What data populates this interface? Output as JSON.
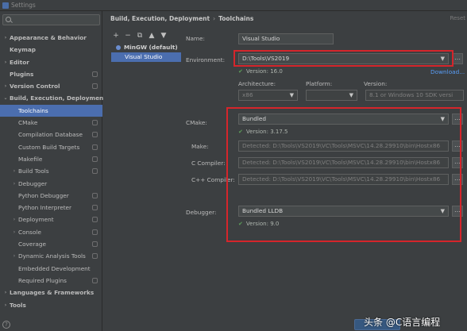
{
  "window": {
    "title": "Settings"
  },
  "sidebar": {
    "items": [
      {
        "label": "Appearance & Behavior",
        "bold": true,
        "arrow": "›",
        "depth": 0
      },
      {
        "label": "Keymap",
        "bold": true,
        "arrow": "",
        "depth": 0
      },
      {
        "label": "Editor",
        "bold": true,
        "arrow": "›",
        "depth": 0
      },
      {
        "label": "Plugins",
        "bold": true,
        "arrow": "",
        "depth": 0,
        "cfg": true
      },
      {
        "label": "Version Control",
        "bold": true,
        "arrow": "›",
        "depth": 0,
        "cfg": true
      },
      {
        "label": "Build, Execution, Deployment",
        "bold": true,
        "arrow": "⌄",
        "depth": 0
      },
      {
        "label": "Toolchains",
        "bold": false,
        "arrow": "",
        "depth": 1,
        "selected": true
      },
      {
        "label": "CMake",
        "bold": false,
        "arrow": "",
        "depth": 1,
        "cfg": true
      },
      {
        "label": "Compilation Database",
        "bold": false,
        "arrow": "",
        "depth": 1,
        "cfg": true
      },
      {
        "label": "Custom Build Targets",
        "bold": false,
        "arrow": "",
        "depth": 1,
        "cfg": true
      },
      {
        "label": "Makefile",
        "bold": false,
        "arrow": "",
        "depth": 1,
        "cfg": true
      },
      {
        "label": "Build Tools",
        "bold": false,
        "arrow": "›",
        "depth": 1,
        "cfg": true
      },
      {
        "label": "Debugger",
        "bold": false,
        "arrow": "›",
        "depth": 1
      },
      {
        "label": "Python Debugger",
        "bold": false,
        "arrow": "",
        "depth": 1,
        "cfg": true
      },
      {
        "label": "Python Interpreter",
        "bold": false,
        "arrow": "",
        "depth": 1,
        "cfg": true
      },
      {
        "label": "Deployment",
        "bold": false,
        "arrow": "›",
        "depth": 1,
        "cfg": true
      },
      {
        "label": "Console",
        "bold": false,
        "arrow": "›",
        "depth": 1,
        "cfg": true
      },
      {
        "label": "Coverage",
        "bold": false,
        "arrow": "",
        "depth": 1,
        "cfg": true
      },
      {
        "label": "Dynamic Analysis Tools",
        "bold": false,
        "arrow": "›",
        "depth": 1,
        "cfg": true
      },
      {
        "label": "Embedded Development",
        "bold": false,
        "arrow": "",
        "depth": 1
      },
      {
        "label": "Required Plugins",
        "bold": false,
        "arrow": "",
        "depth": 1,
        "cfg": true
      },
      {
        "label": "Languages & Frameworks",
        "bold": true,
        "arrow": "›",
        "depth": 0
      },
      {
        "label": "Tools",
        "bold": true,
        "arrow": "›",
        "depth": 0
      }
    ]
  },
  "breadcrumb": {
    "parent": "Build, Execution, Deployment",
    "separator": "›",
    "current": "Toolchains"
  },
  "header": {
    "reset": "Reset"
  },
  "toolchains": {
    "toolbar": [
      "+",
      "−",
      "⧉",
      "▲",
      "▼"
    ],
    "list": [
      {
        "label": "MinGW (default)",
        "bold": true,
        "selected": false
      },
      {
        "label": "Visual Studio",
        "bold": false,
        "selected": true
      }
    ]
  },
  "form": {
    "name_label": "Name:",
    "name_value": "Visual Studio",
    "environment_label": "Environment:",
    "environment_value": "D:\\Tools\\VS2019",
    "environment_version": "Version: 16.0",
    "download_link": "Download...",
    "architecture_label": "Architecture:",
    "architecture_value": "x86",
    "platform_label": "Platform:",
    "platform_value": "",
    "version_label": "Version:",
    "version_value": "8.1 or Windows 10 SDK versi",
    "cmake_label": "CMake:",
    "cmake_value": "Bundled",
    "cmake_version": "Version: 3.17.5",
    "make_label": "Make:",
    "make_value": "Detected: D:\\Tools\\VS2019\\VC\\Tools\\MSVC\\14.28.29910\\bin\\Hostx86",
    "c_compiler_label": "C Compiler:",
    "c_compiler_value": "Detected: D:\\Tools\\VS2019\\VC\\Tools\\MSVC\\14.28.29910\\bin\\Hostx86",
    "cpp_compiler_label": "C++ Compiler:",
    "cpp_compiler_value": "Detected: D:\\Tools\\VS2019\\VC\\Tools\\MSVC\\14.28.29910\\bin\\Hostx86",
    "debugger_label": "Debugger:",
    "debugger_value": "Bundled LLDB",
    "debugger_version": "Version: 9.0"
  },
  "footer": {
    "help": "?",
    "watermark": "头条 @C语言编程"
  },
  "colors": {
    "accent": "#4b6eaf",
    "highlight_box": "#d5252b",
    "ok": "#5d9f5a",
    "link": "#589df6"
  }
}
